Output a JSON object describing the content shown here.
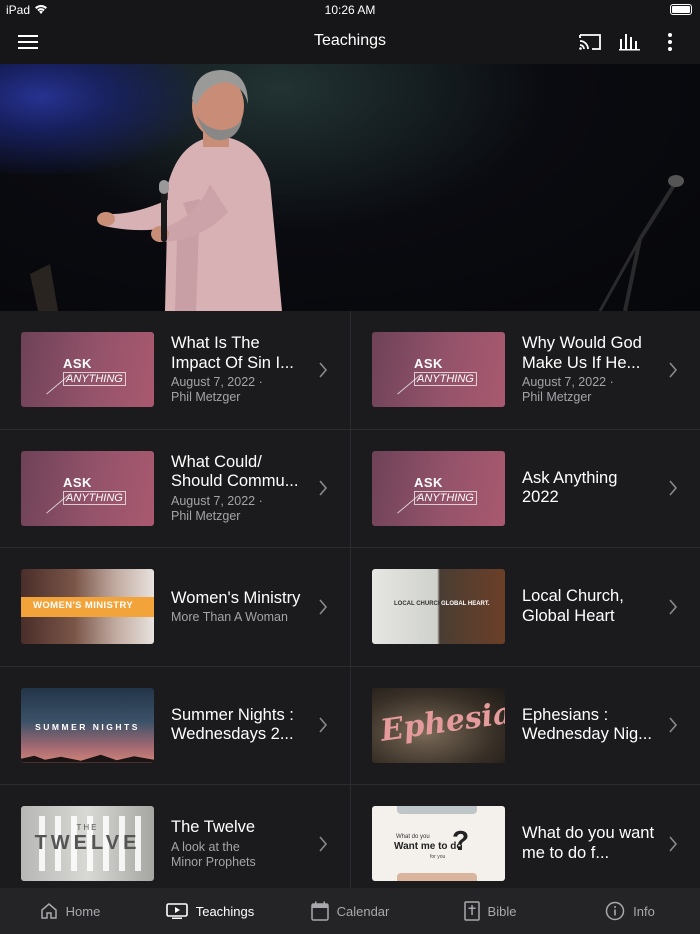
{
  "status": {
    "device": "iPad",
    "time": "10:26 AM"
  },
  "navbar": {
    "title": "Teachings",
    "icons": [
      "menu-icon",
      "cast-icon",
      "audio-bars-icon",
      "more-vertical-icon"
    ]
  },
  "hero": {
    "description_icon": "speaker-photo"
  },
  "teachings": [
    {
      "title": "What Is The Impact Of Sin I...",
      "date": "August 7, 2022 ·",
      "speaker": "Phil Metzger",
      "thumb": "ask",
      "thumb_line1": "ASK",
      "thumb_line2": "ANYTHING"
    },
    {
      "title": "Why Would God Make Us If He...",
      "date": "August 7, 2022 ·",
      "speaker": "Phil Metzger",
      "thumb": "ask",
      "thumb_line1": "ASK",
      "thumb_line2": "ANYTHING"
    },
    {
      "title": "What Could/ Should Commu...",
      "date": "August 7, 2022 ·",
      "speaker": "Phil Metzger",
      "thumb": "ask",
      "thumb_line1": "ASK",
      "thumb_line2": "ANYTHING"
    },
    {
      "title": "Ask Anything 2022",
      "date": "",
      "speaker": "",
      "thumb": "ask",
      "thumb_line1": "ASK",
      "thumb_line2": "ANYTHING"
    },
    {
      "title": "Women's Ministry",
      "subtitle": "More Than A Woman",
      "thumb": "women",
      "thumb_line1": "WOMEN'S MINISTRY"
    },
    {
      "title": "Local Church, Global Heart",
      "subtitle": "",
      "thumb": "local",
      "thumb_line1": "LOCAL CHURCH.",
      "thumb_line2": "GLOBAL HEART."
    },
    {
      "title": "Summer Nights : Wednesdays 2...",
      "subtitle": "",
      "thumb": "summer",
      "thumb_line1": "SUMMER NIGHTS"
    },
    {
      "title": "Ephesians : Wednesday Nig...",
      "subtitle": "",
      "thumb": "eph",
      "thumb_line1": "Ephesians"
    },
    {
      "title": "The Twelve",
      "subtitle": "A look at the Minor Prophets",
      "thumb": "twelve",
      "thumb_line1": "THE",
      "thumb_line2": "TWELVE"
    },
    {
      "title": "What do you want me to do f...",
      "subtitle": "",
      "thumb": "whatdo",
      "thumb_line1": "What do you",
      "thumb_line2": "Want me to do",
      "thumb_line3": "for you"
    }
  ],
  "tabbar": [
    {
      "label": "Home",
      "icon": "home-icon",
      "active": false
    },
    {
      "label": "Teachings",
      "icon": "video-icon",
      "active": true
    },
    {
      "label": "Calendar",
      "icon": "calendar-icon",
      "active": false
    },
    {
      "label": "Bible",
      "icon": "bible-icon",
      "active": false
    },
    {
      "label": "Info",
      "icon": "info-icon",
      "active": false
    }
  ],
  "colors": {
    "background": "#161618",
    "cell": "#1b1b1e",
    "tabbar": "#242427",
    "ask_thumb": "#94536a",
    "women_accent": "#f2a33a"
  }
}
